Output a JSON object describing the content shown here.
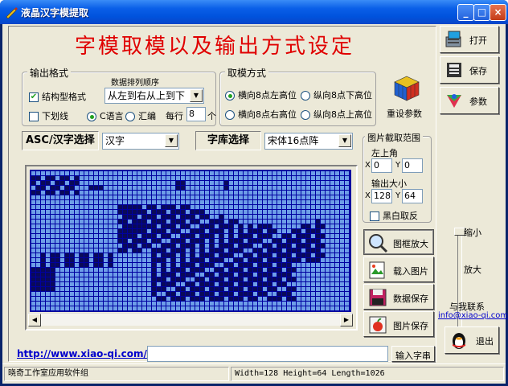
{
  "window": {
    "title": "液晶汉字模提取",
    "buttons": {
      "minimize": "_",
      "maximize": "□",
      "close": "×"
    }
  },
  "heading": "字模取模以及输出方式设定",
  "output_format": {
    "group_label": "输出格式",
    "order_label": "数据排列顺序",
    "structured_label": "结构型格式",
    "structured_checked": true,
    "underline_label": "下划线",
    "underline_checked": false,
    "order_value": "从左到右从上到下",
    "lang_c_label": "C语言",
    "lang_asm_label": "汇编",
    "selected_lang": "C语言",
    "per_row_label": "每行",
    "per_row_value": "8",
    "per_row_unit": "个"
  },
  "scan_mode": {
    "group_label": "取模方式",
    "options": [
      {
        "label": "横向8点左高位",
        "selected": true
      },
      {
        "label": "纵向8点下高位",
        "selected": false
      },
      {
        "label": "横向8点右高位",
        "selected": false
      },
      {
        "label": "纵向8点上高位",
        "selected": false
      }
    ],
    "reset_label": "重设参数"
  },
  "charset": {
    "label": "ASC/汉字选择",
    "value": "汉字",
    "library_label": "字库选择",
    "library_value": "宋体16点阵"
  },
  "capture_range": {
    "group_label": "图片截取范围",
    "top_left_label": "左上角",
    "x_label": "X",
    "y_label": "Y",
    "x_value": "0",
    "y_value": "0",
    "size_label": "输出大小",
    "width_value": "128",
    "height_value": "64",
    "invert_label": "黑白取反",
    "invert_checked": false
  },
  "tool_buttons": {
    "zoom": "图框放大",
    "load": "载入图片",
    "save_data": "数据保存",
    "save_image": "图片保存"
  },
  "side_buttons": {
    "open": "打开",
    "save": "保存",
    "params": "参数",
    "exit": "退出"
  },
  "zoom_slider": {
    "shrink_label": "缩小",
    "enlarge_label": "放大"
  },
  "contact": {
    "label": "与我联系",
    "email": "info@xiao-qi.com"
  },
  "bottom": {
    "url": "http://www.xiao-qi.com/",
    "input_value": "",
    "input_button": "输入字串"
  },
  "status": {
    "company": "晓奇工作室应用软件组",
    "info": "Width=128  Height=64  Length=1026"
  },
  "colors": {
    "title_red": "#e00000",
    "grid_background": "#0000a0",
    "cell_off": "#6e9ee8",
    "cell_on": "#0a0a5a",
    "link_blue": "#0000cc"
  }
}
